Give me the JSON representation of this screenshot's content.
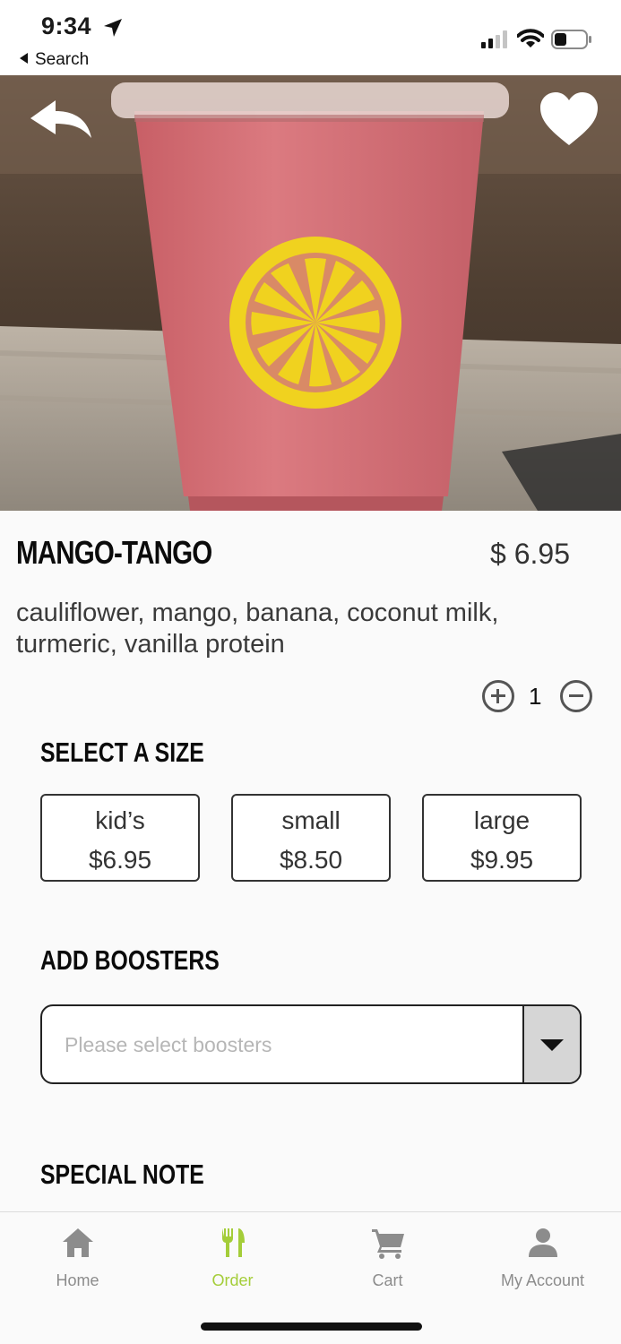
{
  "status_bar": {
    "time": "9:34",
    "back_app": "Search"
  },
  "product": {
    "name": "MANGO-TANGO",
    "price": "$ 6.95",
    "description": "cauliflower, mango, banana, coconut milk, turmeric, vanilla protein",
    "quantity": "1"
  },
  "size_section": {
    "heading": "SELECT A SIZE",
    "options": [
      {
        "name": "kid’s",
        "price": "$6.95"
      },
      {
        "name": "small",
        "price": "$8.50"
      },
      {
        "name": "large",
        "price": "$9.95"
      }
    ]
  },
  "boosters_section": {
    "heading": "ADD BOOSTERS",
    "placeholder": "Please select boosters"
  },
  "note_section": {
    "heading": "SPECIAL NOTE"
  },
  "tabs": [
    {
      "label": "Home",
      "icon": "home-icon",
      "active": false
    },
    {
      "label": "Order",
      "icon": "fork-knife-icon",
      "active": true
    },
    {
      "label": "Cart",
      "icon": "cart-icon",
      "active": false
    },
    {
      "label": "My Account",
      "icon": "person-icon",
      "active": false
    }
  ],
  "colors": {
    "active_tab": "#a4cd39",
    "inactive_tab": "#8c8c8c",
    "logo_yellow": "#f0d21f",
    "smoothie_pink": "#d56d73"
  }
}
